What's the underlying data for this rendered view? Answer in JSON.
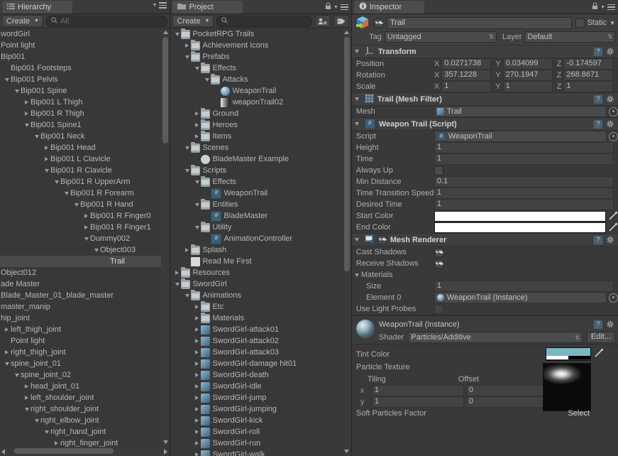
{
  "hierarchy": {
    "tab_label": "Hierarchy",
    "create_label": "Create",
    "search_placeholder": "All",
    "rows": [
      {
        "label": "wordGirl",
        "depth": 0,
        "tw": "none",
        "ind": -10
      },
      {
        "label": "Point light",
        "depth": 0,
        "tw": "none",
        "ind": -10
      },
      {
        "label": "Bip001",
        "depth": 0,
        "tw": "none",
        "ind": -10
      },
      {
        "label": "Bip001 Footsteps",
        "depth": 1,
        "tw": "none",
        "ind": -10
      },
      {
        "label": "Bip001 Pelvis",
        "depth": 1,
        "tw": "down",
        "ind": -10
      },
      {
        "label": "Bip001 Spine",
        "depth": 2,
        "tw": "down",
        "ind": -10
      },
      {
        "label": "Bip001 L Thigh",
        "depth": 3,
        "tw": "right",
        "ind": -10
      },
      {
        "label": "Bip001 R Thigh",
        "depth": 3,
        "tw": "right",
        "ind": -10
      },
      {
        "label": "Bip001 Spine1",
        "depth": 3,
        "tw": "down",
        "ind": -10
      },
      {
        "label": "Bip001 Neck",
        "depth": 4,
        "tw": "down",
        "ind": -10
      },
      {
        "label": "Bip001 Head",
        "depth": 5,
        "tw": "right",
        "ind": -10
      },
      {
        "label": "Bip001 L Clavicle",
        "depth": 5,
        "tw": "right",
        "ind": -10
      },
      {
        "label": "Bip001 R Clavicle",
        "depth": 5,
        "tw": "down",
        "ind": -10
      },
      {
        "label": "Bip001 R UpperArm",
        "depth": 6,
        "tw": "down",
        "ind": -10
      },
      {
        "label": "Bip001 R Forearm",
        "depth": 7,
        "tw": "down",
        "ind": -10
      },
      {
        "label": "Bip001 R Hand",
        "depth": 8,
        "tw": "down",
        "ind": -10
      },
      {
        "label": "Bip001 R Finger0",
        "depth": 9,
        "tw": "right",
        "ind": -10
      },
      {
        "label": "Bip001 R Finger1",
        "depth": 9,
        "tw": "right",
        "ind": -10
      },
      {
        "label": "Dummy002",
        "depth": 9,
        "tw": "down",
        "ind": -10
      },
      {
        "label": "Object003",
        "depth": 10,
        "tw": "down",
        "ind": -10
      },
      {
        "label": "Trail",
        "depth": 11,
        "tw": "none",
        "selected": true,
        "ind": -10
      },
      {
        "label": "Object012",
        "depth": 0,
        "tw": "none",
        "ind": -10
      },
      {
        "label": "ade Master",
        "depth": 0,
        "tw": "none",
        "ind": -10
      },
      {
        "label": "Blade_Master_01_blade_master",
        "depth": 0,
        "tw": "none",
        "ind": -10
      },
      {
        "label": "master_manip",
        "depth": 0,
        "tw": "none",
        "ind": -10
      },
      {
        "label": "hip_joint",
        "depth": 0,
        "tw": "down",
        "ind": -10
      },
      {
        "label": "left_thigh_joint",
        "depth": 1,
        "tw": "right",
        "ind": -10
      },
      {
        "label": "Point light",
        "depth": 1,
        "tw": "none",
        "ind": -10
      },
      {
        "label": "right_thigh_joint",
        "depth": 1,
        "tw": "right",
        "ind": -10
      },
      {
        "label": "spine_joint_01",
        "depth": 1,
        "tw": "down",
        "ind": -10
      },
      {
        "label": "spine_joint_02",
        "depth": 2,
        "tw": "down",
        "ind": -10
      },
      {
        "label": "head_joint_01",
        "depth": 3,
        "tw": "right",
        "ind": -10
      },
      {
        "label": "left_shoulder_joint",
        "depth": 3,
        "tw": "right",
        "ind": -10
      },
      {
        "label": "right_shoulder_joint",
        "depth": 3,
        "tw": "down",
        "ind": -10
      },
      {
        "label": "right_elbow_joint",
        "depth": 4,
        "tw": "down",
        "ind": -10
      },
      {
        "label": "right_hand_joint",
        "depth": 5,
        "tw": "down",
        "ind": -10
      },
      {
        "label": "right_finger_joint",
        "depth": 6,
        "tw": "right",
        "ind": -10
      }
    ]
  },
  "project": {
    "tab_label": "Project",
    "create_label": "Create",
    "search_placeholder": "",
    "rows": [
      {
        "label": "PocketRPG Trails",
        "depth": 0,
        "tw": "down",
        "icon": "folder-icon"
      },
      {
        "label": "Achievement Icons",
        "depth": 1,
        "tw": "right",
        "icon": "folder-icon"
      },
      {
        "label": "Prefabs",
        "depth": 1,
        "tw": "down",
        "icon": "folder-icon"
      },
      {
        "label": "Effects",
        "depth": 2,
        "tw": "down",
        "icon": "folder-icon"
      },
      {
        "label": "Attacks",
        "depth": 3,
        "tw": "down",
        "icon": "folder-icon"
      },
      {
        "label": "WeaponTrail",
        "depth": 4,
        "tw": "none",
        "icon": "prefab-icon"
      },
      {
        "label": "weaponTrail02",
        "depth": 4,
        "tw": "none",
        "icon": "texture-icon"
      },
      {
        "label": "Ground",
        "depth": 2,
        "tw": "right",
        "icon": "folder-icon"
      },
      {
        "label": "Heroes",
        "depth": 2,
        "tw": "right",
        "icon": "folder-icon"
      },
      {
        "label": "Items",
        "depth": 2,
        "tw": "right",
        "icon": "folder-icon"
      },
      {
        "label": "Scenes",
        "depth": 1,
        "tw": "down",
        "icon": "folder-icon"
      },
      {
        "label": "BladeMaster Example",
        "depth": 2,
        "tw": "none",
        "icon": "scene-icon"
      },
      {
        "label": "Scripts",
        "depth": 1,
        "tw": "down",
        "icon": "folder-icon"
      },
      {
        "label": "Effects",
        "depth": 2,
        "tw": "down",
        "icon": "folder-icon"
      },
      {
        "label": "WeaponTrail",
        "depth": 3,
        "tw": "none",
        "icon": "script-icon"
      },
      {
        "label": "Entities",
        "depth": 2,
        "tw": "down",
        "icon": "folder-icon"
      },
      {
        "label": "BladeMaster",
        "depth": 3,
        "tw": "none",
        "icon": "script-icon"
      },
      {
        "label": "Utility",
        "depth": 2,
        "tw": "down",
        "icon": "folder-icon"
      },
      {
        "label": "AnimationController",
        "depth": 3,
        "tw": "none",
        "icon": "script-icon"
      },
      {
        "label": "Splash",
        "depth": 1,
        "tw": "right",
        "icon": "folder-icon"
      },
      {
        "label": "Read Me First",
        "depth": 1,
        "tw": "none",
        "icon": "document-icon"
      },
      {
        "label": "Resources",
        "depth": 0,
        "tw": "right",
        "icon": "folder-icon"
      },
      {
        "label": "SwordGirl",
        "depth": 0,
        "tw": "down",
        "icon": "folder-icon"
      },
      {
        "label": "Animations",
        "depth": 1,
        "tw": "down",
        "icon": "folder-icon"
      },
      {
        "label": "Etc",
        "depth": 2,
        "tw": "right",
        "icon": "folder-icon"
      },
      {
        "label": "Materials",
        "depth": 2,
        "tw": "right",
        "icon": "folder-icon"
      },
      {
        "label": "SwordGirl-attack01",
        "depth": 2,
        "tw": "right",
        "icon": "mesh-icon"
      },
      {
        "label": "SwordGirl-attack02",
        "depth": 2,
        "tw": "right",
        "icon": "mesh-icon"
      },
      {
        "label": "SwordGirl-attack03",
        "depth": 2,
        "tw": "right",
        "icon": "mesh-icon"
      },
      {
        "label": "SwordGirl-damage hit01",
        "depth": 2,
        "tw": "right",
        "icon": "mesh-icon"
      },
      {
        "label": "SwordGirl-death",
        "depth": 2,
        "tw": "right",
        "icon": "mesh-icon"
      },
      {
        "label": "SwordGirl-idle",
        "depth": 2,
        "tw": "right",
        "icon": "mesh-icon"
      },
      {
        "label": "SwordGirl-jump",
        "depth": 2,
        "tw": "right",
        "icon": "mesh-icon"
      },
      {
        "label": "SwordGirl-jumping",
        "depth": 2,
        "tw": "right",
        "icon": "mesh-icon"
      },
      {
        "label": "SwordGirl-kick",
        "depth": 2,
        "tw": "right",
        "icon": "mesh-icon"
      },
      {
        "label": "SwordGirl-roll",
        "depth": 2,
        "tw": "right",
        "icon": "mesh-icon"
      },
      {
        "label": "SwordGirl-run",
        "depth": 2,
        "tw": "right",
        "icon": "mesh-icon"
      },
      {
        "label": "SwordGirl-walk",
        "depth": 2,
        "tw": "right",
        "icon": "mesh-icon"
      }
    ]
  },
  "inspector": {
    "tab_label": "Inspector",
    "object": {
      "name": "Trail",
      "enabled": true,
      "static_label": "Static",
      "static_checked": false,
      "tag_label": "Tag",
      "tag_value": "Untagged",
      "layer_label": "Layer",
      "layer_value": "Default"
    },
    "transform": {
      "title": "Transform",
      "position_label": "Position",
      "rotation_label": "Rotation",
      "scale_label": "Scale",
      "axis_x": "X",
      "axis_y": "Y",
      "axis_z": "Z",
      "position": {
        "x": "0.0271738",
        "y": "0.034099",
        "z": "-0.174597"
      },
      "rotation": {
        "x": "357.1228",
        "y": "270.1947",
        "z": "268.8671"
      },
      "scale": {
        "x": "1",
        "y": "1",
        "z": "1"
      }
    },
    "mesh_filter": {
      "title": "Trail (Mesh Filter)",
      "mesh_label": "Mesh",
      "mesh_value": "Trail"
    },
    "weapon_trail": {
      "title": "Weapon Trail (Script)",
      "script_label": "Script",
      "script_value": "WeaponTrail",
      "height_label": "Height",
      "height_value": "1",
      "time_label": "Time",
      "time_value": "1",
      "always_up_label": "Always Up",
      "always_up_checked": false,
      "min_distance_label": "Min Distance",
      "min_distance_value": "0.1",
      "time_transition_label": "Time Transition Speed",
      "time_transition_value": "1",
      "desired_time_label": "Desired Time",
      "desired_time_value": "1",
      "start_color_label": "Start Color",
      "start_color_value": "#ffffff",
      "end_color_label": "End Color",
      "end_color_value": "#ffffff"
    },
    "mesh_renderer": {
      "title": "Mesh Renderer",
      "enabled": true,
      "cast_shadows_label": "Cast Shadows",
      "cast_shadows_checked": true,
      "receive_shadows_label": "Receive Shadows",
      "receive_shadows_checked": true,
      "materials_label": "Materials",
      "size_label": "Size",
      "size_value": "1",
      "element0_label": "Element 0",
      "element0_value": "WeaponTrail (Instance)",
      "light_probes_label": "Use Light Probes",
      "light_probes_checked": false
    },
    "material": {
      "title": "WeaponTrail (Instance)",
      "shader_label": "Shader",
      "shader_value": "Particles/Additive",
      "edit_label": "Edit...",
      "tint_color_label": "Tint Color",
      "tint_color_value": "#7ab5c4",
      "particle_texture_label": "Particle Texture",
      "tiling_label": "Tiling",
      "offset_label": "Offset",
      "x_label": "x",
      "y_label": "y",
      "tiling_x": "1",
      "tiling_y": "1",
      "offset_x": "0",
      "offset_y": "0",
      "select_label": "Select",
      "soft_particles_label": "Soft Particles Factor"
    }
  }
}
